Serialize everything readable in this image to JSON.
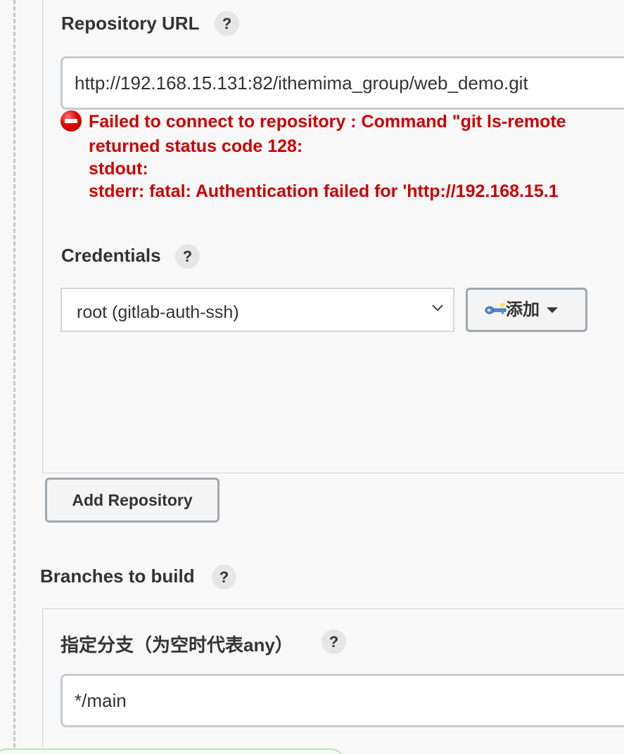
{
  "repository": {
    "url_label": "Repository URL",
    "url_value": "http://192.168.15.131:82/ithemima_group/web_demo.git",
    "help": "?",
    "error": {
      "line1": "Failed to connect to repository : Command \"git ls-remote",
      "line2": "returned status code 128:",
      "line3": "stdout:",
      "line4": "stderr: fatal: Authentication failed for 'http://192.168.15.1"
    }
  },
  "credentials": {
    "label": "Credentials",
    "help": "?",
    "selected": "root (gitlab-auth-ssh)",
    "add_button_label": "添加",
    "icons": {
      "add": "key-icon",
      "dropdown": "chevron-down-icon"
    }
  },
  "add_repository_button": "Add Repository",
  "branches": {
    "label": "Branches to build",
    "help": "?",
    "spec_label": "指定分支（为空时代表any）",
    "spec_help": "?",
    "spec_value": "*/main"
  },
  "colors": {
    "error": "#cc0000",
    "border": "#c6cbd1",
    "background": "#f8f8f8"
  }
}
